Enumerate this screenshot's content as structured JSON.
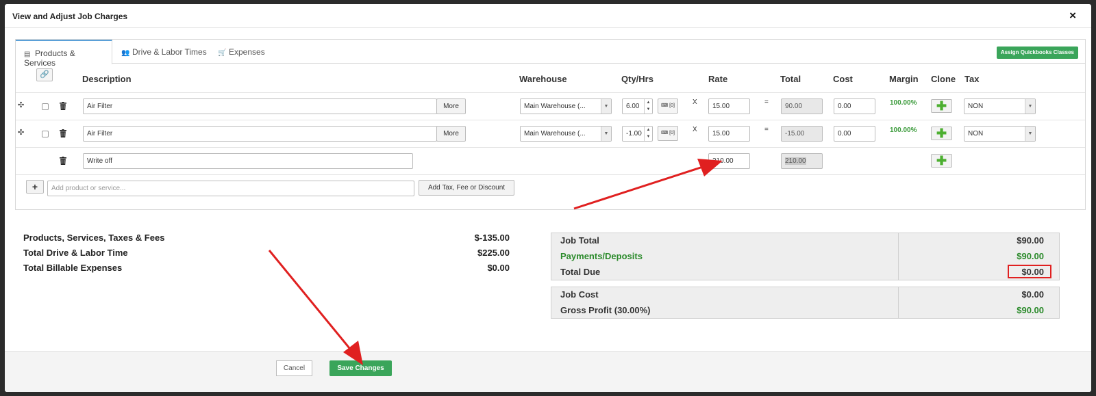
{
  "modal": {
    "title": "View and Adjust Job Charges",
    "close": "×"
  },
  "tabs": [
    {
      "label": "Products & Services",
      "icon": "clipboard-icon"
    },
    {
      "label": "Drive & Labor Times",
      "icon": "people-icon"
    },
    {
      "label": "Expenses",
      "icon": "cart-icon"
    }
  ],
  "assign_button": "Assign Quickbooks Classes",
  "columns": {
    "description": "Description",
    "warehouse": "Warehouse",
    "qty": "Qty/Hrs",
    "rate": "Rate",
    "total": "Total",
    "cost": "Cost",
    "margin": "Margin",
    "clone": "Clone",
    "tax": "Tax"
  },
  "rows": [
    {
      "description": "Air Filter",
      "more": "More",
      "warehouse": "Main Warehouse (...",
      "qty": "6.00",
      "kbd": "[0]",
      "x": "X",
      "rate": "15.00",
      "eq": "=",
      "total": "90.00",
      "cost": "0.00",
      "margin": "100.00%",
      "tax": "NON"
    },
    {
      "description": "Air Filter",
      "more": "More",
      "warehouse": "Main Warehouse (...",
      "qty": "-1.00",
      "kbd": "[0]",
      "x": "X",
      "rate": "15.00",
      "eq": "=",
      "total": "-15.00",
      "cost": "0.00",
      "margin": "100.00%",
      "tax": "NON"
    },
    {
      "description": "Write off",
      "rate": "210.00",
      "total": "210.00"
    }
  ],
  "add_row": {
    "placeholder": "Add product or service...",
    "add_tax_button": "Add Tax, Fee or Discount",
    "plus": "+"
  },
  "summary_left": [
    {
      "label": "Products, Services, Taxes & Fees",
      "amount": "$-135.00"
    },
    {
      "label": "Total Drive & Labor Time",
      "amount": "$225.00"
    },
    {
      "label": "Total Billable Expenses",
      "amount": "$0.00"
    }
  ],
  "totals_box": [
    {
      "label": "Job Total",
      "amount": "$90.00"
    },
    {
      "label": "Payments/Deposits",
      "amount": "$90.00"
    },
    {
      "label": "Total Due",
      "amount": "$0.00"
    }
  ],
  "profit_box": [
    {
      "label": "Job Cost",
      "amount": "$0.00"
    },
    {
      "label": "Gross Profit (30.00%)",
      "amount": "$90.00"
    }
  ],
  "footer": {
    "cancel": "Cancel",
    "save": "Save Changes"
  },
  "colors": {
    "accent_green": "#3aa55a",
    "annotation_red": "#e02020",
    "tab_blue": "#5aa0d8"
  }
}
